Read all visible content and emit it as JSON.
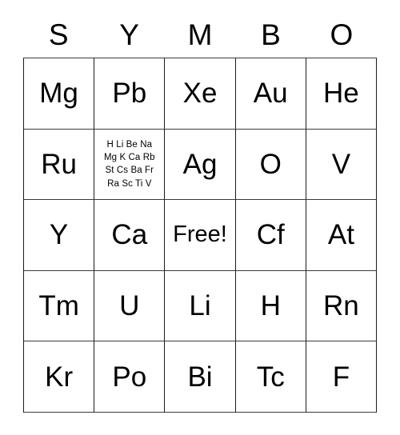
{
  "card": {
    "header_letters": [
      "S",
      "Y",
      "M",
      "B",
      "O"
    ],
    "free_label": "Free!",
    "rows": [
      {
        "cells": [
          {
            "text": "Mg"
          },
          {
            "text": "Pb"
          },
          {
            "text": "Xe"
          },
          {
            "text": "Au"
          },
          {
            "text": "He"
          }
        ]
      },
      {
        "cells": [
          {
            "text": "Ru"
          },
          {
            "text": "H Li Be Na\nMg K Ca Rb\nSt Cs Ba Fr\nRa Sc Ti V"
          },
          {
            "text": "Ag"
          },
          {
            "text": "O"
          },
          {
            "text": "V"
          }
        ]
      },
      {
        "cells": [
          {
            "text": "Y"
          },
          {
            "text": "Ca"
          },
          {
            "text": "Free!"
          },
          {
            "text": "Cf"
          },
          {
            "text": "At"
          }
        ]
      },
      {
        "cells": [
          {
            "text": "Tm"
          },
          {
            "text": "U"
          },
          {
            "text": "Li"
          },
          {
            "text": "H"
          },
          {
            "text": "Rn"
          }
        ]
      },
      {
        "cells": [
          {
            "text": "Kr"
          },
          {
            "text": "Po"
          },
          {
            "text": "Bi"
          },
          {
            "text": "Tc"
          },
          {
            "text": "F"
          }
        ]
      }
    ]
  },
  "colors": {
    "background": "#ffffff",
    "text": "#000000",
    "grid_line": "#1a1a1a"
  }
}
